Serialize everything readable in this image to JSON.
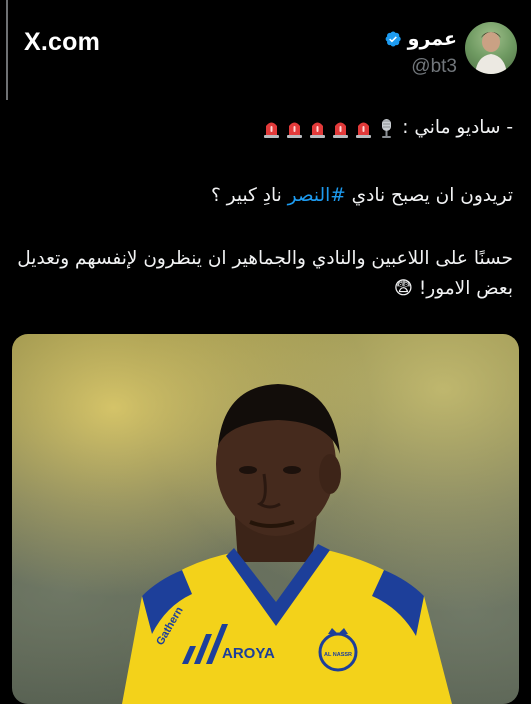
{
  "brand": {
    "site": "X.com"
  },
  "tweet": {
    "author_name": "عمرو",
    "handle": "@bt3",
    "line1": "- ساديو ماني :",
    "line2_before": "تريدون ان يصبح نادي ",
    "hashtag": "#النصر",
    "line2_after": " نادِ كبير ؟",
    "line3": "حسنًا على اللاعبين والنادي والجماهير ان ينظرون لإنفسهم وتعديل بعض الامور! 😨",
    "emojis": [
      "microphone-icon",
      "siren-icon",
      "siren-icon",
      "siren-icon",
      "siren-icon",
      "siren-icon"
    ]
  },
  "photo": {
    "jersey_text": "AROYA",
    "sleeve_text": "Gathern",
    "badge_text": "AL NASSR"
  },
  "colors": {
    "hashtag": "#1d9bf0",
    "verified": "#1d9bf0",
    "jersey": "#f3d21a",
    "jersey_trim": "#1d3f9a"
  }
}
